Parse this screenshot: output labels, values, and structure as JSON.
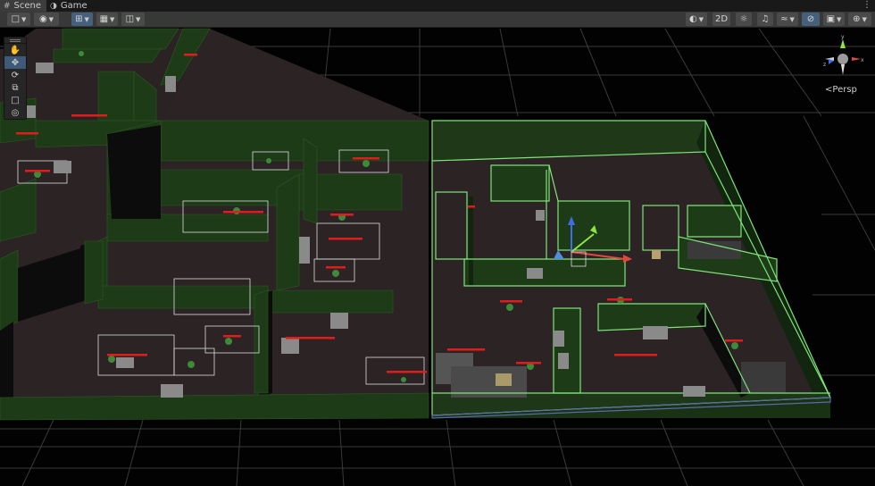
{
  "tabs": [
    {
      "label": "Scene",
      "icon": "scene-grid-icon",
      "active": true
    },
    {
      "label": "Game",
      "icon": "gamepad-icon",
      "active": false
    }
  ],
  "toolbar": {
    "left": [
      "draw-mode",
      "global-local",
      "view-options",
      "grid-snapping",
      "increment-snap"
    ],
    "view_2d_label": "2D",
    "right": [
      "shading-mode",
      "lighting",
      "audio",
      "effects",
      "visibility",
      "camera",
      "gizmos"
    ]
  },
  "tools": [
    "hand-tool",
    "move-tool",
    "rotate-tool",
    "scale-tool",
    "rect-tool",
    "transform-tool"
  ],
  "selected_tool": "move-tool",
  "gizmo": {
    "persp_label": "Persp"
  },
  "colors": {
    "wall": "#1d3b17",
    "wall_dark": "#12260f",
    "floor": "#2b2324",
    "selection": "#7fe57a",
    "health_bar": "#e01c1c",
    "grid": "#3a3a3a",
    "axis_x": "#e04a3a",
    "axis_y": "#8ee63f",
    "axis_z": "#3d6ee6"
  }
}
